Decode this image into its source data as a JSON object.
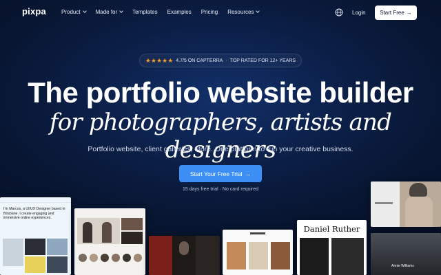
{
  "nav": {
    "logo": "pixpa",
    "items": [
      {
        "label": "Product",
        "dropdown": true
      },
      {
        "label": "Made for",
        "dropdown": true
      },
      {
        "label": "Templates",
        "dropdown": false
      },
      {
        "label": "Examples",
        "dropdown": false
      },
      {
        "label": "Pricing",
        "dropdown": false
      },
      {
        "label": "Resources",
        "dropdown": true
      }
    ],
    "globe_icon": "globe-icon",
    "login": "Login",
    "start_free": "Start Free",
    "arrow": "→"
  },
  "rating": {
    "stars": "★★★★★",
    "text": "4.7/5 ON CAPTERRA",
    "separator": "·",
    "badge": "TOP RATED FOR 12+ YEARS"
  },
  "hero": {
    "headline": "The portfolio website builder",
    "headline_italic": "for photographers, artists and designers",
    "subtext": "Portfolio website, client galleries, store. One platform to run your creative business.",
    "cta": "Start Your Free Trial",
    "cta_arrow": "→",
    "note": "15 days free trial · No card required"
  },
  "showcase": {
    "card1_text": "I'm Marcos, a UI/UX Designer based in Brisbane. I create engaging and immersive online experiences.",
    "card5_name": "Daniel Ruther",
    "card7_label": "Annie Williams"
  },
  "colors": {
    "accent": "#3d8ff5",
    "star": "#f39b2f",
    "bg_dark": "#081632"
  }
}
